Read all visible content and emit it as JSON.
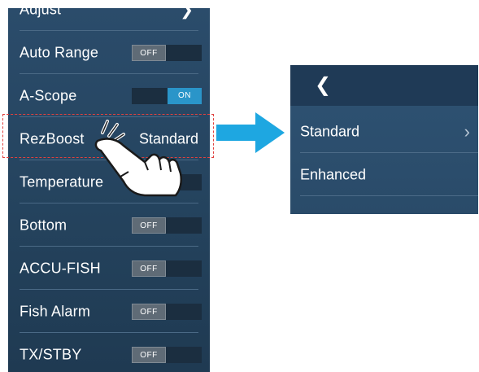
{
  "menu": {
    "items": [
      {
        "label": "Adjust",
        "control": "chevron"
      },
      {
        "label": "Auto Range",
        "control": "toggle",
        "state": "OFF"
      },
      {
        "label": "A-Scope",
        "control": "toggle",
        "state": "ON"
      },
      {
        "label": "RezBoost",
        "control": "value",
        "value": "Standard"
      },
      {
        "label": "Temperature",
        "control": "toggle",
        "state": "OFF"
      },
      {
        "label": "Bottom",
        "control": "toggle",
        "state": "OFF"
      },
      {
        "label": "ACCU-FISH",
        "control": "toggle",
        "state": "OFF"
      },
      {
        "label": "Fish Alarm",
        "control": "toggle",
        "state": "OFF"
      },
      {
        "label": "TX/STBY",
        "control": "toggle",
        "state": "OFF"
      }
    ]
  },
  "submenu": {
    "back_icon": "chevron-left-icon",
    "items": [
      {
        "label": "Standard",
        "selected": true
      },
      {
        "label": "Enhanced",
        "selected": false
      }
    ]
  },
  "colors": {
    "panel": "#25445f",
    "toggle_on": "#2a95c9",
    "toggle_off": "#5f6b76",
    "highlight": "#e0413e",
    "arrow": "#1ea7e1"
  }
}
